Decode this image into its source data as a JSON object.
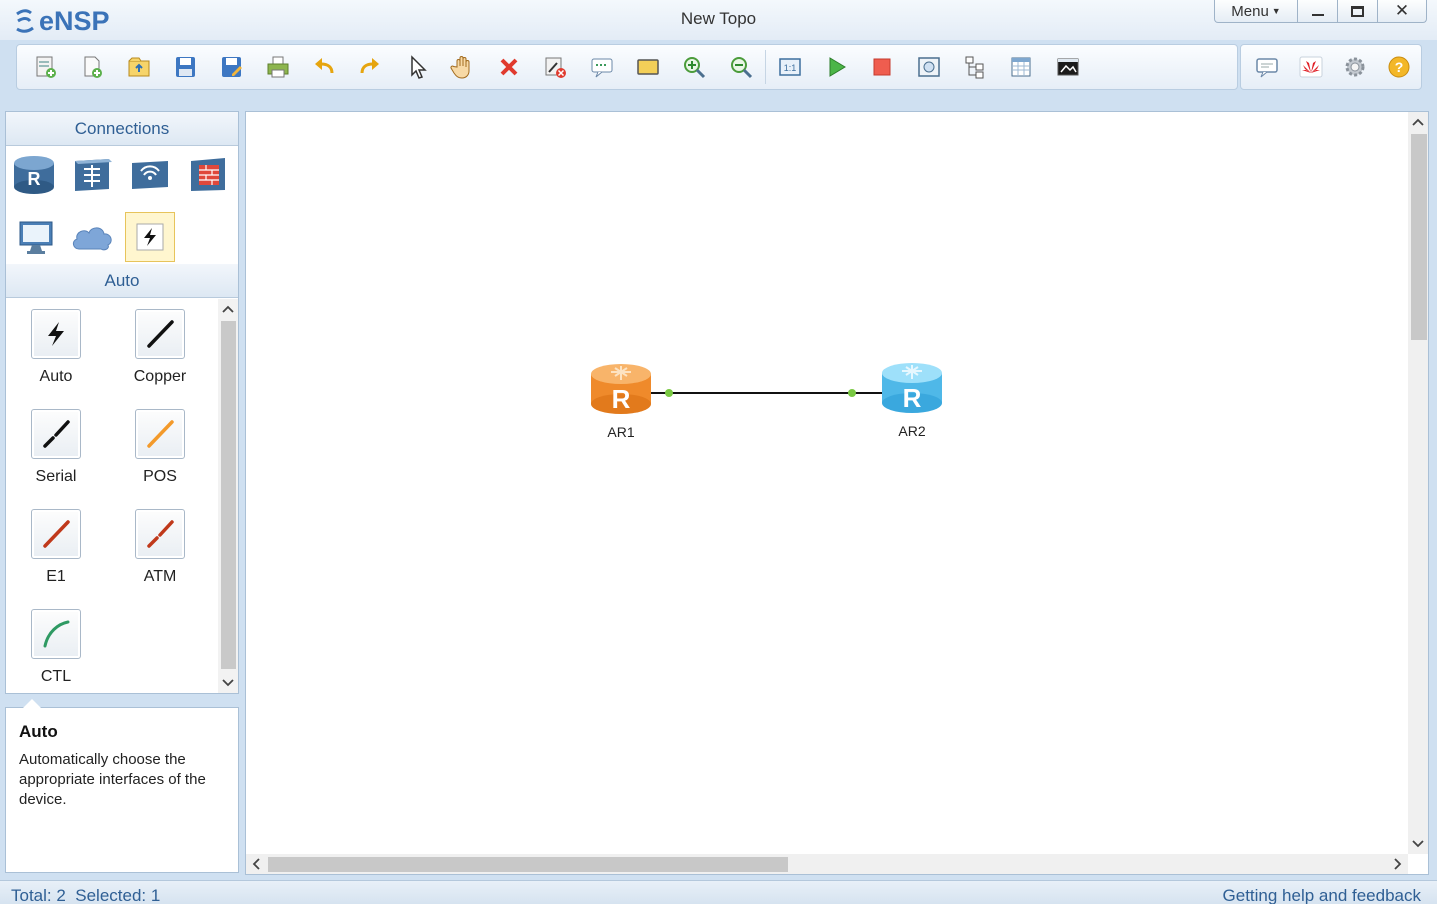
{
  "app": {
    "name": "eNSP",
    "window_title": "New Topo",
    "menu_label": "Menu",
    "minimize_glyph": "—",
    "maximize_glyph": "□",
    "close_glyph": "✕"
  },
  "toolbar": {
    "icons": [
      "new-topo-icon",
      "new-example-icon",
      "open-icon",
      "save-icon",
      "save-as-icon",
      "print-icon",
      "undo-icon",
      "redo-icon",
      "select-icon",
      "pan-hand-icon",
      "delete-icon",
      "delete-link-icon",
      "text-note-icon",
      "rectangle-icon",
      "zoom-in-icon",
      "zoom-out-icon",
      "fit-icon",
      "start-icon",
      "stop-icon",
      "capture-icon",
      "topology-icon",
      "grid-icon",
      "cli-icon"
    ],
    "right_icons": [
      "feedback-icon",
      "huawei-icon",
      "settings-icon",
      "help-icon"
    ]
  },
  "left_panel": {
    "header": "Connections",
    "categories": [
      "router",
      "switch",
      "wlan",
      "firewall",
      "pc",
      "cloud",
      "connection"
    ],
    "selected_category": "connection",
    "subheader": "Auto",
    "connections": [
      {
        "label": "Auto",
        "icon": "auto-link-icon",
        "color": "#111111"
      },
      {
        "label": "Copper",
        "icon": "copper-link-icon",
        "color": "#111111"
      },
      {
        "label": "Serial",
        "icon": "serial-link-icon",
        "color": "#111111"
      },
      {
        "label": "POS",
        "icon": "pos-link-icon",
        "color": "#f39a2b"
      },
      {
        "label": "E1",
        "icon": "e1-link-icon",
        "color": "#c0391b"
      },
      {
        "label": "ATM",
        "icon": "atm-link-icon",
        "color": "#c0391b"
      },
      {
        "label": "CTL",
        "icon": "ctl-link-icon",
        "color": "#2f9a63"
      }
    ]
  },
  "description": {
    "title": "Auto",
    "text": "Automatically choose the appropriate interfaces of the device."
  },
  "topology": {
    "nodes": [
      {
        "label": "AR1",
        "color": "#f39a3c",
        "selected": true
      },
      {
        "label": "AR2",
        "color": "#5ec4ee",
        "selected": false
      }
    ],
    "link_endpoint_color": "#7ac943"
  },
  "status": {
    "left": "Total: 2  Selected: 1",
    "right": "Getting help and feedback"
  }
}
